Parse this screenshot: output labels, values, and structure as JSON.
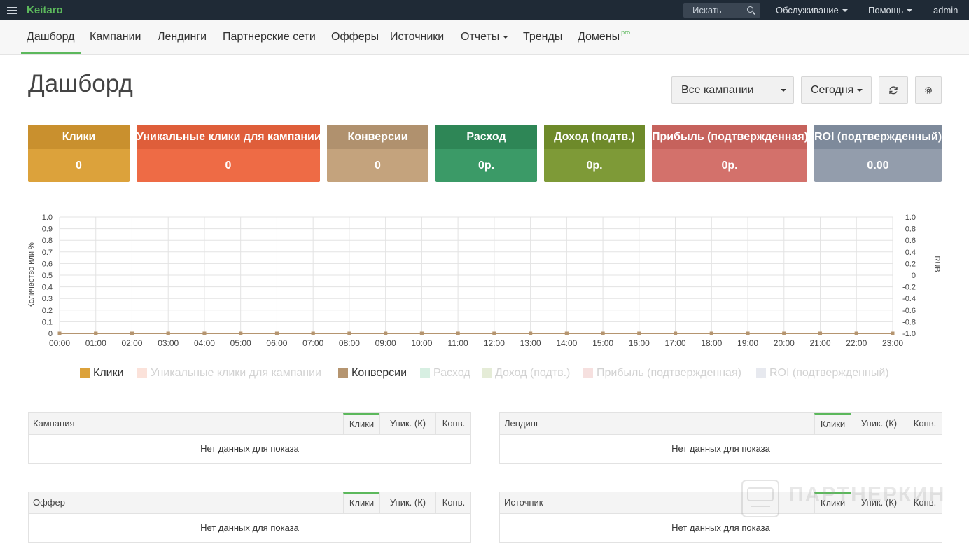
{
  "app": {
    "brand": "Keitaro"
  },
  "topbar": {
    "search_placeholder": "Искать",
    "menu": [
      "Обслуживание",
      "Помощь",
      "admin"
    ]
  },
  "nav": {
    "items": [
      "Дашборд",
      "Кампании",
      "Лендинги",
      "Партнерские сети",
      "Офферы",
      "Источники",
      "Отчеты",
      "Тренды",
      "Домены"
    ],
    "pro_badge": "pro",
    "active": "Дашборд"
  },
  "page": {
    "title": "Дашборд"
  },
  "controls": {
    "campaign_select": "Все кампании",
    "date_select": "Сегодня"
  },
  "stats": [
    {
      "label": "Клики",
      "value": "0",
      "head_color": "#c9902e",
      "body_color": "#dca23b"
    },
    {
      "label": "Уникальные клики для кампании",
      "value": "0",
      "head_color": "#df5e3a",
      "body_color": "#ee6b45"
    },
    {
      "label": "Конверсии",
      "value": "0",
      "head_color": "#b0916e",
      "body_color": "#c4a37d"
    },
    {
      "label": "Расход",
      "value": "0р.",
      "head_color": "#2e8656",
      "body_color": "#3b9a67"
    },
    {
      "label": "Доход (подтв.)",
      "value": "0р.",
      "head_color": "#6e8a2a",
      "body_color": "#7e9a37"
    },
    {
      "label": "Прибыль (подтвержденная)",
      "value": "0р.",
      "head_color": "#c6625c",
      "body_color": "#d3716b"
    },
    {
      "label": "ROI (подтвержденный)",
      "value": "0.00",
      "head_color": "#7e8a9b",
      "body_color": "#939dac"
    }
  ],
  "chart_data": {
    "type": "line",
    "ylabel": "Количество или %",
    "y2label": "RUB",
    "ylim": [
      0,
      1.0
    ],
    "y2lim": [
      -1.0,
      1.0
    ],
    "y_ticks": [
      "0",
      "0.1",
      "0.2",
      "0.3",
      "0.4",
      "0.5",
      "0.6",
      "0.7",
      "0.8",
      "0.9",
      "1.0"
    ],
    "y2_ticks": [
      "-1.0",
      "-0.8",
      "-0.6",
      "-0.4",
      "-0.2",
      "0",
      "0.2",
      "0.4",
      "0.6",
      "0.8",
      "1.0"
    ],
    "x": [
      "00:00",
      "01:00",
      "02:00",
      "03:00",
      "04:00",
      "05:00",
      "06:00",
      "07:00",
      "08:00",
      "09:00",
      "10:00",
      "11:00",
      "12:00",
      "13:00",
      "14:00",
      "15:00",
      "16:00",
      "17:00",
      "18:00",
      "19:00",
      "20:00",
      "21:00",
      "22:00",
      "23:00"
    ],
    "grid": true,
    "legend_position": "bottom",
    "series": [
      {
        "name": "Клики",
        "color": "#dca23b",
        "active": true,
        "values": [
          0,
          0,
          0,
          0,
          0,
          0,
          0,
          0,
          0,
          0,
          0,
          0,
          0,
          0,
          0,
          0,
          0,
          0,
          0,
          0,
          0,
          0,
          0,
          0
        ]
      },
      {
        "name": "Уникальные клики для кампании",
        "color": "#fbe2da",
        "active": false,
        "values": []
      },
      {
        "name": "Конверсии",
        "color": "#b59570",
        "active": true,
        "values": [
          0,
          0,
          0,
          0,
          0,
          0,
          0,
          0,
          0,
          0,
          0,
          0,
          0,
          0,
          0,
          0,
          0,
          0,
          0,
          0,
          0,
          0,
          0,
          0
        ]
      },
      {
        "name": "Расход",
        "color": "#d7efe2",
        "active": false,
        "values": []
      },
      {
        "name": "Доход (подтв.)",
        "color": "#e5ecd7",
        "active": false,
        "values": []
      },
      {
        "name": "Прибыль (подтвержденная)",
        "color": "#f6e0df",
        "active": false,
        "values": []
      },
      {
        "name": "ROI (подтвержденный)",
        "color": "#e7e9ef",
        "active": false,
        "values": []
      }
    ]
  },
  "tables": [
    {
      "title": "Кампания",
      "cols": [
        "Клики",
        "Уник. (К)",
        "Конв."
      ],
      "empty": "Нет данных для показа"
    },
    {
      "title": "Лендинг",
      "cols": [
        "Клики",
        "Уник. (К)",
        "Конв."
      ],
      "empty": "Нет данных для показа"
    },
    {
      "title": "Оффер",
      "cols": [
        "Клики",
        "Уник. (К)",
        "Конв."
      ],
      "empty": "Нет данных для показа"
    },
    {
      "title": "Источник",
      "cols": [
        "Клики",
        "Уник. (К)",
        "Конв."
      ],
      "empty": "Нет данных для показа"
    }
  ],
  "watermark": {
    "text": "ПАРТНЕРКИН"
  }
}
